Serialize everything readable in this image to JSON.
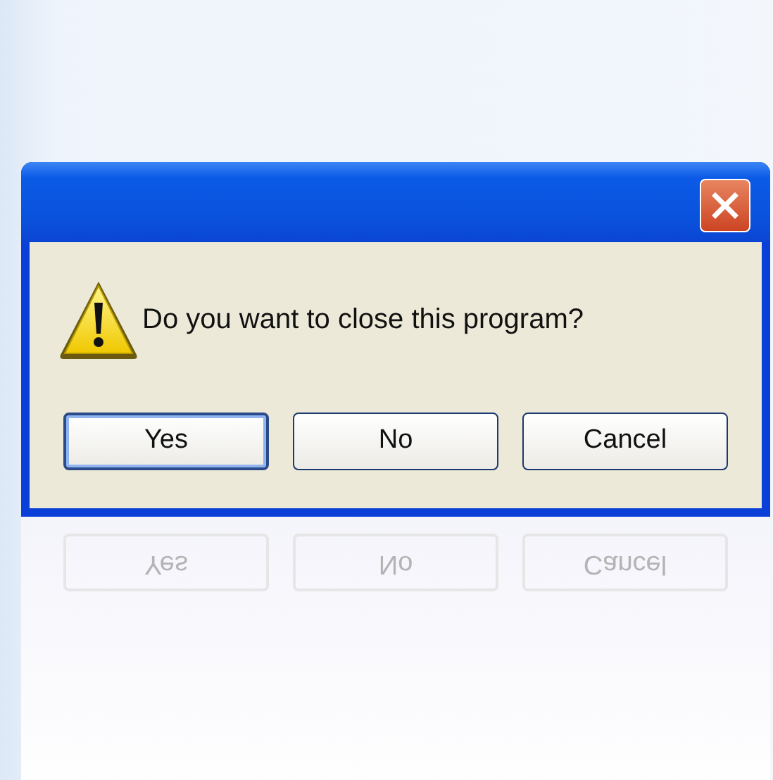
{
  "dialog": {
    "message": "Do you want to close this program?"
  },
  "buttons": [
    {
      "label": "Yes",
      "default": true
    },
    {
      "label": "No",
      "default": false
    },
    {
      "label": "Cancel",
      "default": false
    }
  ],
  "reflection": {
    "buttons": [
      "Yes",
      "No",
      "Cancel"
    ]
  }
}
